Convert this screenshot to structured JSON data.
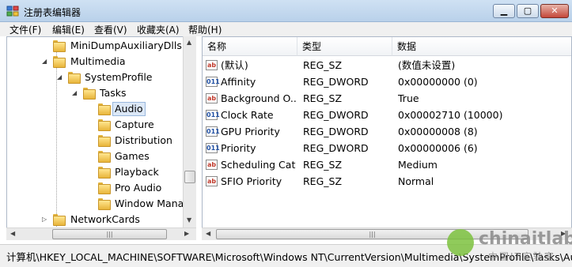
{
  "window": {
    "title": "注册表编辑器"
  },
  "window_controls": {
    "minimize": "▁",
    "maximize": "▢",
    "close": "✕"
  },
  "menu": [
    {
      "label": "文件(F)"
    },
    {
      "label": "编辑(E)"
    },
    {
      "label": "查看(V)"
    },
    {
      "label": "收藏夹(A)"
    },
    {
      "label": "帮助(H)"
    }
  ],
  "tree": {
    "items": [
      {
        "label": "MiniDumpAuxiliaryDlls",
        "expander": ""
      },
      {
        "label": "Multimedia",
        "expander": "◢"
      },
      {
        "label": "SystemProfile",
        "expander": "◢"
      },
      {
        "label": "Tasks",
        "expander": "◢"
      },
      {
        "label": "Audio",
        "expander": "",
        "selected": true
      },
      {
        "label": "Capture",
        "expander": ""
      },
      {
        "label": "Distribution",
        "expander": ""
      },
      {
        "label": "Games",
        "expander": ""
      },
      {
        "label": "Playback",
        "expander": ""
      },
      {
        "label": "Pro Audio",
        "expander": ""
      },
      {
        "label": "Window Manag",
        "expander": ""
      },
      {
        "label": "NetworkCards",
        "expander": "▷"
      }
    ]
  },
  "list": {
    "columns": {
      "name": "名称",
      "type": "类型",
      "data": "数据"
    },
    "rows": [
      {
        "icon": "string-value-icon",
        "name": "(默认)",
        "type": "REG_SZ",
        "data": "(数值未设置)"
      },
      {
        "icon": "dword-value-icon",
        "name": "Affinity",
        "type": "REG_DWORD",
        "data": "0x00000000 (0)"
      },
      {
        "icon": "string-value-icon",
        "name": "Background O...",
        "type": "REG_SZ",
        "data": "True"
      },
      {
        "icon": "dword-value-icon",
        "name": "Clock Rate",
        "type": "REG_DWORD",
        "data": "0x00002710 (10000)"
      },
      {
        "icon": "dword-value-icon",
        "name": "GPU Priority",
        "type": "REG_DWORD",
        "data": "0x00000008 (8)"
      },
      {
        "icon": "dword-value-icon",
        "name": "Priority",
        "type": "REG_DWORD",
        "data": "0x00000006 (6)"
      },
      {
        "icon": "string-value-icon",
        "name": "Scheduling Cat...",
        "type": "REG_SZ",
        "data": "Medium"
      },
      {
        "icon": "string-value-icon",
        "name": "SFIO Priority",
        "type": "REG_SZ",
        "data": "Normal"
      }
    ]
  },
  "icons": {
    "string": "ab",
    "dword": "011"
  },
  "status": {
    "path": "计算机\\HKEY_LOCAL_MACHINE\\SOFTWARE\\Microsoft\\Windows NT\\CurrentVersion\\Multimedia\\SystemProfile\\Tasks\\Audio"
  },
  "watermark": {
    "name": "chinaitlab",
    "subtitle": "中国IT实验室"
  }
}
